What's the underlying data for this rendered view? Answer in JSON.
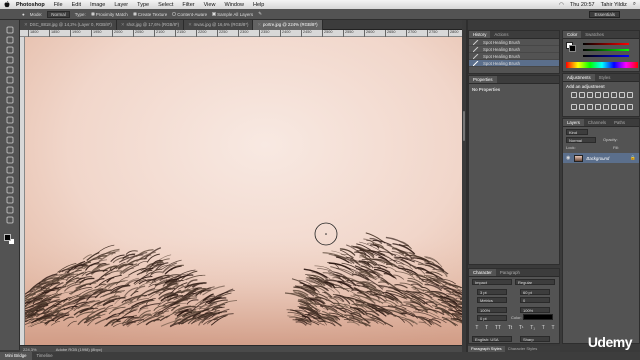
{
  "menubar": {
    "app_name": "Photoshop",
    "items": [
      "File",
      "Edit",
      "Image",
      "Layer",
      "Type",
      "Select",
      "Filter",
      "View",
      "Window",
      "Help"
    ],
    "clock": "Thu 20:57",
    "user": "Tahir Yildiz"
  },
  "window": {
    "title": "Adobe Photoshop CS6"
  },
  "options": {
    "mode_label": "Mode:",
    "mode_value": "Normal",
    "type_label": "Type:",
    "proximity": "Proximity Match",
    "create_texture": "Create Texture",
    "content_aware": "Content-Aware",
    "sample_all": "Sample All Layers",
    "workspace": "Essentials"
  },
  "tabs": [
    "DSC_8818.jpg @ 14,2% (Layer 0, RGB/8*)",
    "shot.jpg @ 17,6% (RGB/8*)",
    "mvas.jpg @ 16,6% (RGB/8*)",
    "portre.jpg @ 224% (RGB/8*)"
  ],
  "ruler_ticks": [
    "1800",
    "1850",
    "1900",
    "1950",
    "2000",
    "2050",
    "2100",
    "2150",
    "2200",
    "2250",
    "2300",
    "2350",
    "2400",
    "2450",
    "2500",
    "2550",
    "2600",
    "2650",
    "2700",
    "2750",
    "2800"
  ],
  "status": {
    "zoom": "224,3%",
    "doc": "Adobe RGB (1998) (8bpc)"
  },
  "bottom_tabs": [
    "Mini Bridge",
    "Timeline"
  ],
  "history": {
    "tabs": [
      "History",
      "Actions"
    ],
    "items": [
      "Spot Healing Brush",
      "Spot Healing Brush",
      "Spot Healing Brush",
      "Spot Healing Brush"
    ]
  },
  "properties": {
    "tab": "Properties",
    "empty": "No Properties"
  },
  "color_panel": {
    "tabs": [
      "Color",
      "Swatches"
    ]
  },
  "adjustments": {
    "tabs": [
      "Adjustments",
      "Styles"
    ],
    "heading": "Add an adjustment"
  },
  "layers": {
    "tabs": [
      "Layers",
      "Channels",
      "Paths"
    ],
    "kind": "Kind",
    "blend": "Normal",
    "opacity_label": "Opacity:",
    "lock_label": "Lock:",
    "fill_label": "Fill:",
    "layer_name": "Background"
  },
  "character": {
    "tabs": [
      "Character",
      "Paragraph"
    ],
    "font": "Impact",
    "style": "Regular",
    "size": "3 pt",
    "leading": "60 pt",
    "tracking_font": "Metrics",
    "tracking": "0",
    "scale_v": "100%",
    "scale_h": "100%",
    "baseline": "0 pt",
    "color_label": "Color:",
    "language": "English: USA",
    "aa": "Sharp"
  },
  "para_styles": [
    "Paragraph Styles",
    "Character Styles"
  ],
  "watermark": "Udemy",
  "colors": {
    "accent": "#5b6f8c",
    "panel": "#535353",
    "dark": "#3c3c3c"
  }
}
